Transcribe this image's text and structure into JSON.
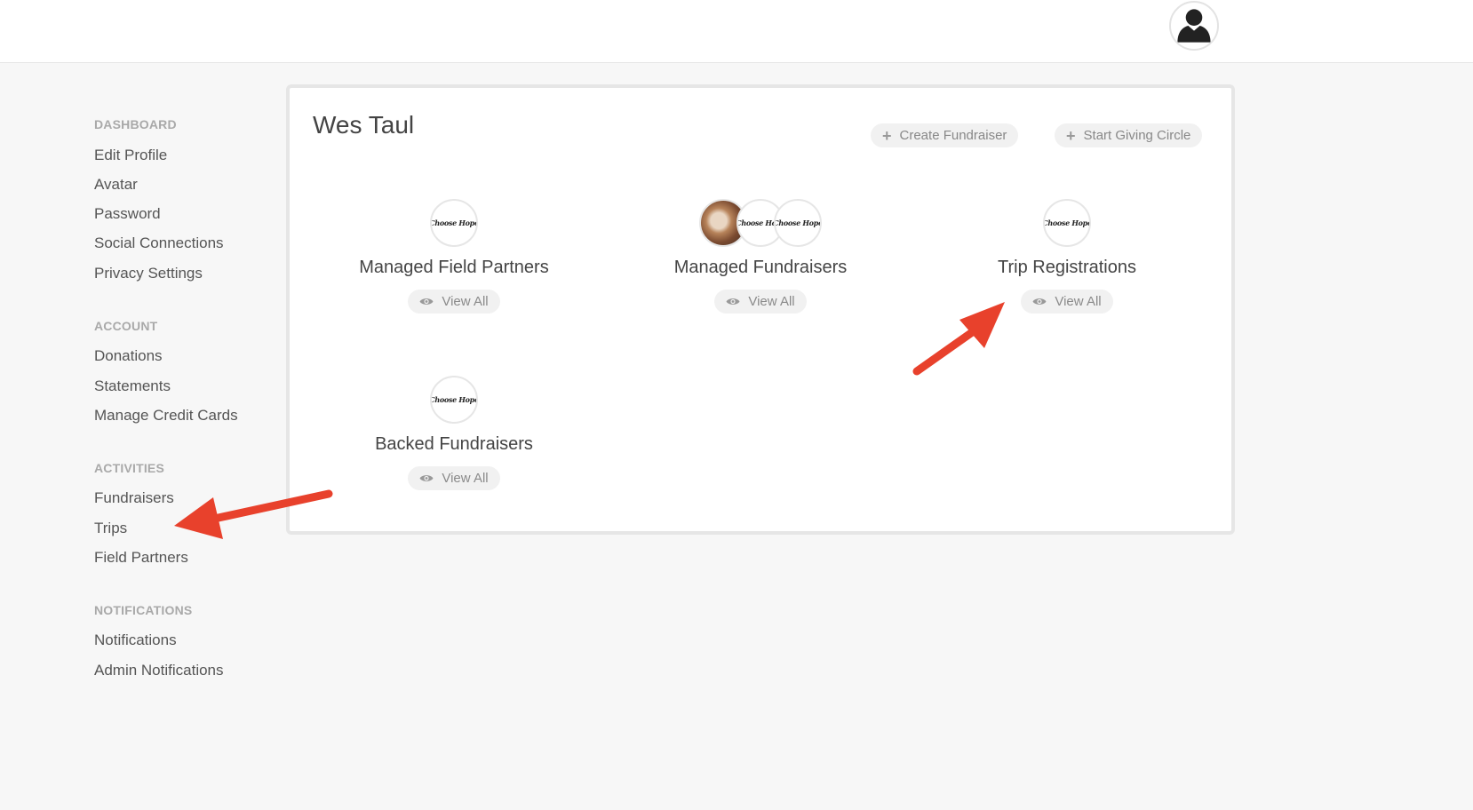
{
  "header": {
    "avatar_icon": "user-silhouette-icon"
  },
  "sidebar": {
    "sections": [
      {
        "heading": "DASHBOARD",
        "items": [
          "Edit Profile",
          "Avatar",
          "Password",
          "Social Connections",
          "Privacy Settings"
        ]
      },
      {
        "heading": "ACCOUNT",
        "items": [
          "Donations",
          "Statements",
          "Manage Credit Cards"
        ]
      },
      {
        "heading": "ACTIVITIES",
        "items": [
          "Fundraisers",
          "Trips",
          "Field Partners"
        ]
      },
      {
        "heading": "NOTIFICATIONS",
        "items": [
          "Notifications",
          "Admin Notifications"
        ]
      }
    ]
  },
  "card": {
    "title": "Wes Taul",
    "create_fundraiser": "Create Fundraiser",
    "start_giving_circle": "Start Giving Circle",
    "tiles": [
      {
        "label": "Managed Field Partners",
        "view": "View All"
      },
      {
        "label": "Managed Fundraisers",
        "view": "View All"
      },
      {
        "label": "Trip Registrations",
        "view": "View All"
      },
      {
        "label": "Backed Fundraisers",
        "view": "View All"
      }
    ],
    "logo_text": "Choose Hope"
  },
  "colors": {
    "background": "#f7f7f7",
    "card_border": "#e6e6e6",
    "annotation_arrow": "#e8412c"
  }
}
